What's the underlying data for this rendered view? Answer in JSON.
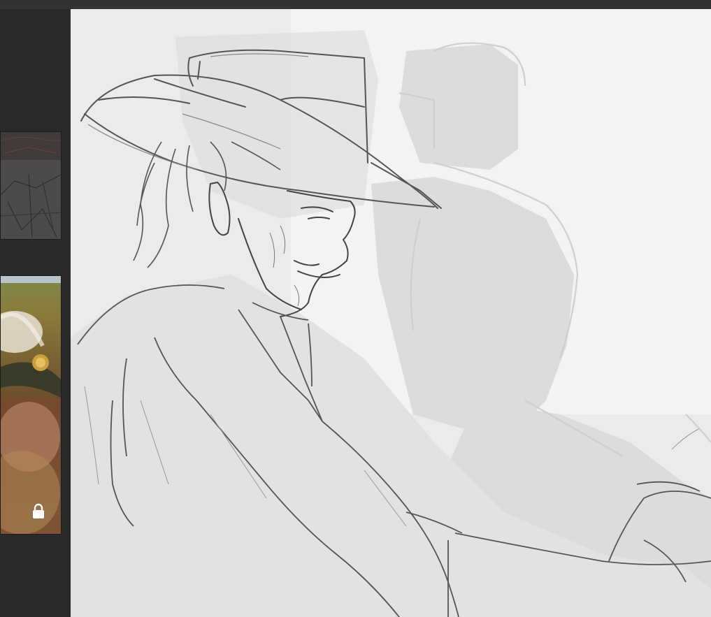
{
  "app": {
    "theme": "dark",
    "accent_color": "#2b2b2b"
  },
  "reference_panel": {
    "items": [
      {
        "name": "sketch-reference-thumbnail",
        "locked": false
      },
      {
        "name": "photo-reference-thumbnail",
        "locked": true
      }
    ],
    "lock_icon": "lock-icon"
  },
  "canvas": {
    "background_color": "#ebebeb",
    "artwork": "pencil-sketch"
  }
}
